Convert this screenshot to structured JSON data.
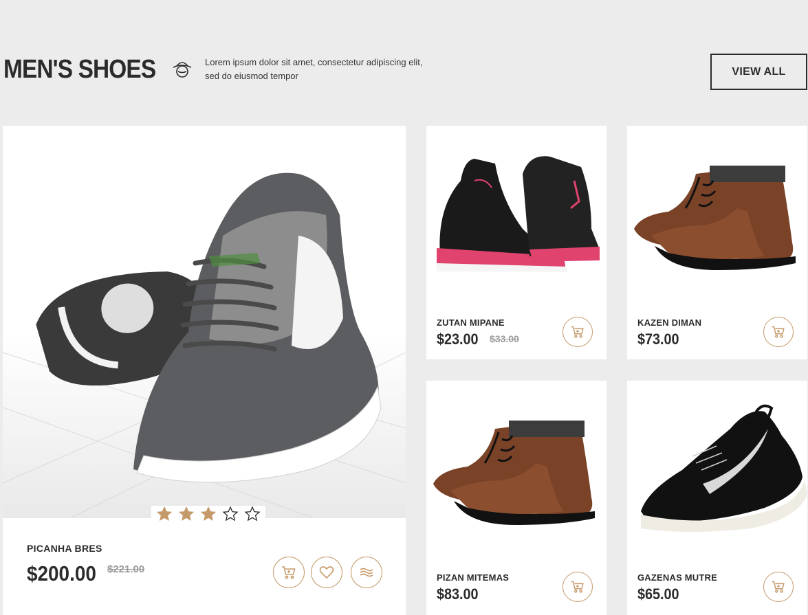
{
  "section": {
    "title": "MEN'S SHOES",
    "description_line1": "Lorem ipsum dolor sit amet, consectetur adipiscing elit,",
    "description_line2": "sed do eiusmod tempor",
    "view_all_label": "VIEW ALL",
    "icon": "hat-icon"
  },
  "colors": {
    "accent": "#c59a6a",
    "text": "#2b2b2b",
    "background": "#ececec",
    "star_filled": "#c59a6a"
  },
  "featured": {
    "name": "PICANHA BRES",
    "price": "$200.00",
    "old_price": "$221.00",
    "rating": 3,
    "rating_max": 5,
    "actions": [
      "cart-icon",
      "heart-icon",
      "compare-icon"
    ]
  },
  "products": [
    {
      "name": "ZUTAN MIPANE",
      "price": "$23.00",
      "old_price": "$33.00"
    },
    {
      "name": "KAZEN DIMAN",
      "price": "$73.00",
      "old_price": ""
    },
    {
      "name": "PIZAN MITEMAS",
      "price": "$83.00",
      "old_price": ""
    },
    {
      "name": "GAZENAS MUTRE",
      "price": "$65.00",
      "old_price": ""
    }
  ]
}
